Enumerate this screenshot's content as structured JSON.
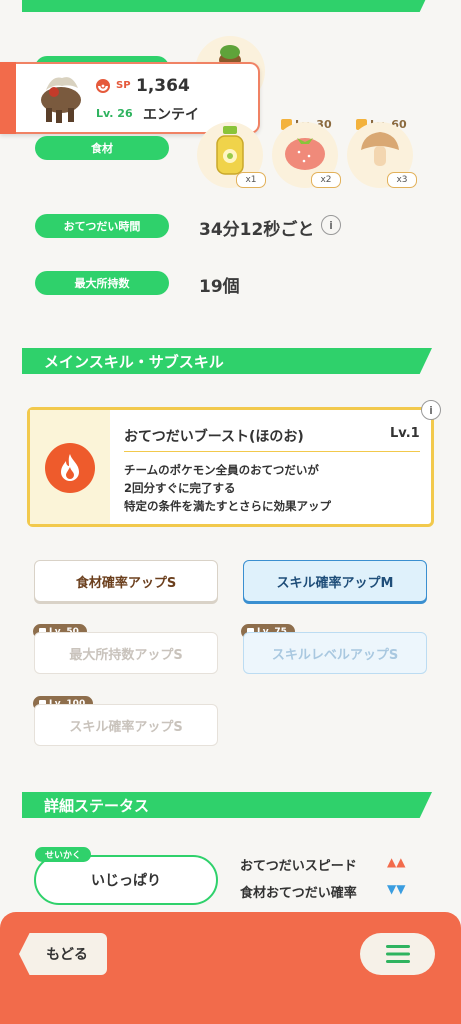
{
  "pokemon": {
    "sp_label": "SP",
    "sp_value": "1,364",
    "level": "Lv. 26",
    "name": "エンテイ"
  },
  "ingredients": {
    "label": "食材",
    "items": [
      {
        "name": "honey",
        "multiplier": "x1",
        "unlock": ""
      },
      {
        "name": "tomato",
        "multiplier": "x2",
        "unlock": "Lv. 30"
      },
      {
        "name": "mushroom",
        "multiplier": "x3",
        "unlock": "Lv. 60"
      }
    ]
  },
  "help_time": {
    "label": "おてつだい時間",
    "value": "34分12秒ごと"
  },
  "max_carry": {
    "label": "最大所持数",
    "value": "19個"
  },
  "skills_section": {
    "title": "メインスキル・サブスキル"
  },
  "main_skill": {
    "name": "おてつだいブースト(ほのお)",
    "level": "Lv.1",
    "desc_line1": "チームのポケモン全員のおてつだいが",
    "desc_line2": "2回分すぐに完了する",
    "desc_line3": "特定の条件を満たすとさらに効果アップ",
    "accent_color": "#ee5b2c"
  },
  "subskills": [
    {
      "label": "食材確率アップS",
      "unlock": ""
    },
    {
      "label": "スキル確率アップM",
      "unlock": ""
    },
    {
      "label": "最大所持数アップS",
      "unlock": "Lv. 50"
    },
    {
      "label": "スキルレベルアップS",
      "unlock": "Lv. 75"
    },
    {
      "label": "スキル確率アップS",
      "unlock": "Lv. 100"
    }
  ],
  "details_section": {
    "title": "詳細ステータス"
  },
  "nature": {
    "tag": "せいかく",
    "value": "いじっぱり",
    "up_label": "おてつだいスピード",
    "up_marks": "▲▲",
    "down_label": "食材おてつだい確率",
    "down_marks": "▼▼"
  },
  "footer": {
    "back_label": "もどる"
  },
  "colors": {
    "accent_green": "#2fd16b",
    "footer_orange": "#f26b4b"
  }
}
